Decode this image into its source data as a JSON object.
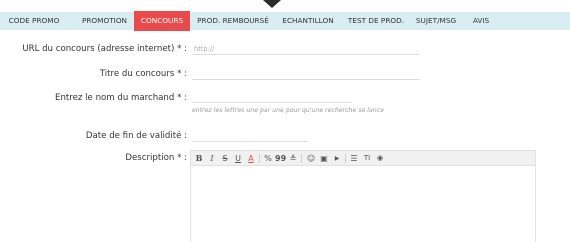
{
  "tabs": [
    {
      "label": "CODE PROMO",
      "active": false
    },
    {
      "label": "PROMOTION",
      "active": false
    },
    {
      "label": "CONCOURS",
      "active": true
    },
    {
      "label": "PROD. REMBOURSÉ",
      "active": false
    },
    {
      "label": "ECHANTILLON",
      "active": false
    },
    {
      "label": "TEST DE PROD.",
      "active": false
    },
    {
      "label": "SUJET/MSG",
      "active": false
    },
    {
      "label": "AVIS",
      "active": false
    }
  ],
  "form": {
    "url_label": "URL du concours (adresse internet) * :",
    "url_placeholder": "http://",
    "title_label": "Titre du concours * :",
    "merchant_label": "Entrez le nom du marchand * :",
    "merchant_hint": "entrez les lettres une par une pour qu'une recherche se lance",
    "end_date_label": "Date de fin de validité :",
    "description_label": "Description * :"
  },
  "editor": {
    "toolbar": {
      "bold": "B",
      "italic": "I",
      "strike": "S",
      "underline": "U",
      "color": "A",
      "link": "%",
      "quote": "99",
      "align": "≜",
      "emoji": "☺",
      "image": "▣",
      "video": "▶",
      "list": "☰",
      "size": "TI",
      "preview": "◉"
    }
  },
  "colors": {
    "tab_bar": "#d9eef3",
    "tab_active": "#e94b4d",
    "color_button": "#e94b4d"
  }
}
